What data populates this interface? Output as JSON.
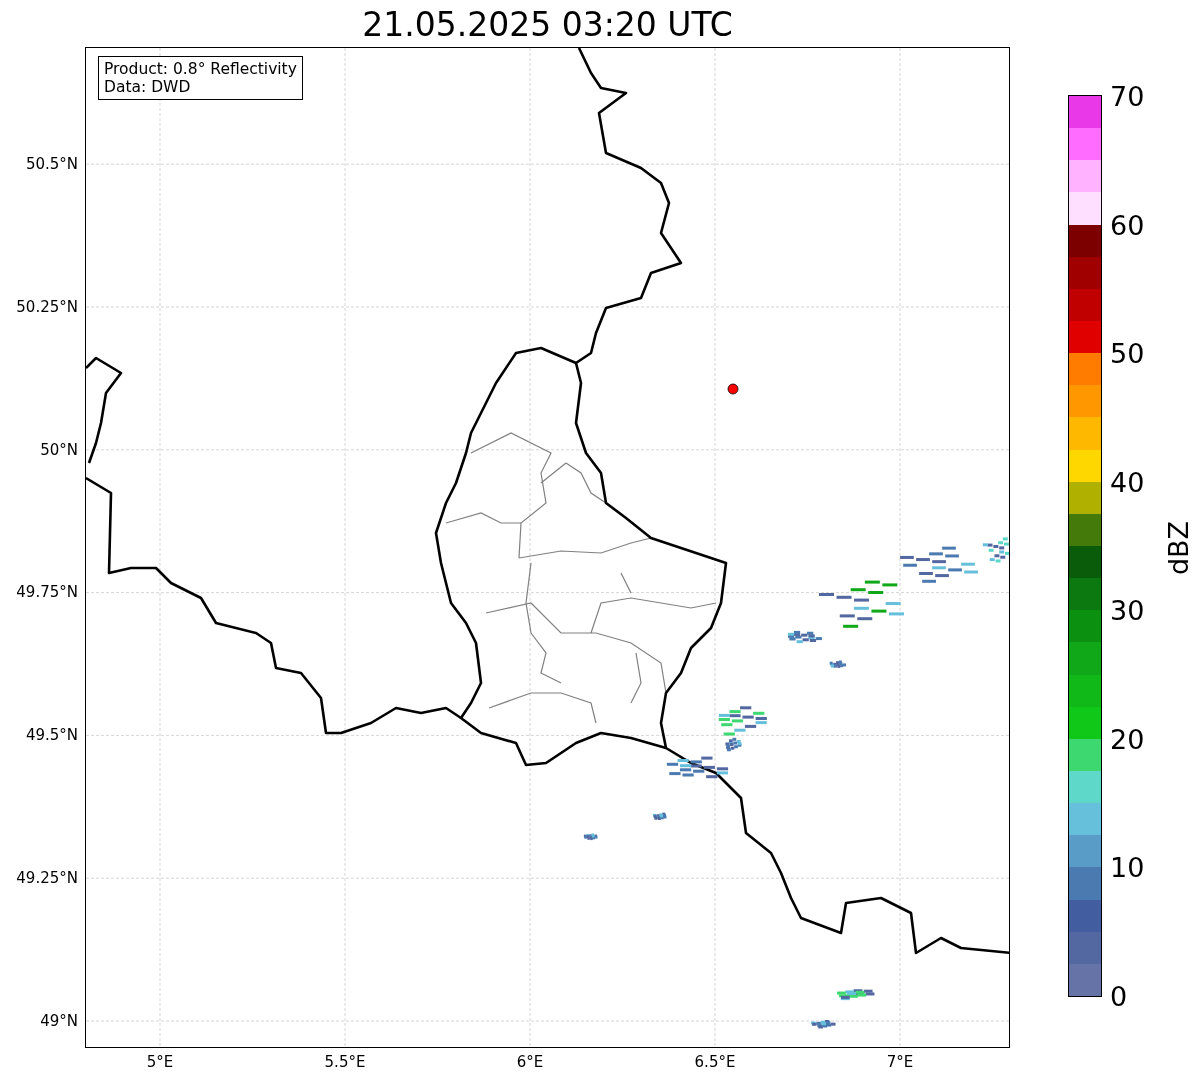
{
  "title": "21.05.2025 03:20 UTC",
  "info_box": [
    "Product: 0.8° Reflectivity",
    "Data: DWD"
  ],
  "x_ticks": [
    "5°E",
    "5.5°E",
    "6°E",
    "6.5°E",
    "7°E"
  ],
  "y_ticks": [
    "50.5°N",
    "50.25°N",
    "50°N",
    "49.75°N",
    "49.5°N",
    "49.25°N",
    "49°N"
  ],
  "colorbar": {
    "label": "dBZ",
    "ticks": [
      "70",
      "60",
      "50",
      "40",
      "30",
      "20",
      "10",
      "0"
    ],
    "bands": [
      {
        "color": "#6573a6"
      },
      {
        "color": "#5367a0"
      },
      {
        "color": "#435ea0"
      },
      {
        "color": "#4a7ab0"
      },
      {
        "color": "#5a9cc8"
      },
      {
        "color": "#66c0dc"
      },
      {
        "color": "#5ed8c8"
      },
      {
        "color": "#3ed870"
      },
      {
        "color": "#10c818"
      },
      {
        "color": "#10b818"
      },
      {
        "color": "#10a818"
      },
      {
        "color": "#0c9010"
      },
      {
        "color": "#0c7810"
      },
      {
        "color": "#0a5c0a"
      },
      {
        "color": "#447a0a"
      },
      {
        "color": "#b0b000"
      },
      {
        "color": "#ffd700"
      },
      {
        "color": "#ffb800"
      },
      {
        "color": "#ff9800"
      },
      {
        "color": "#ff7c00"
      },
      {
        "color": "#e00000"
      },
      {
        "color": "#c00000"
      },
      {
        "color": "#a00000"
      },
      {
        "color": "#7c0000"
      },
      {
        "color": "#ffdfff"
      },
      {
        "color": "#ffb2ff"
      },
      {
        "color": "#ff6cff"
      },
      {
        "color": "#e838e8"
      }
    ]
  }
}
